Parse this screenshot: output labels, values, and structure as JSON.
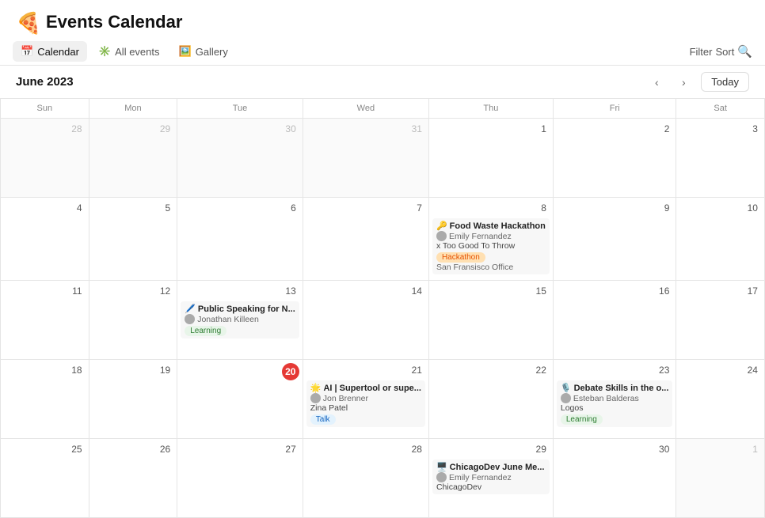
{
  "app": {
    "title": "Events Calendar",
    "logo_emoji": "🍕"
  },
  "nav": {
    "tabs": [
      {
        "id": "calendar",
        "label": "Calendar",
        "icon": "📅",
        "active": true
      },
      {
        "id": "all-events",
        "label": "All events",
        "icon": "✳️",
        "active": false
      },
      {
        "id": "gallery",
        "label": "Gallery",
        "icon": "🖼️",
        "active": false
      }
    ]
  },
  "toolbar": {
    "filter_label": "Filter",
    "sort_label": "Sort",
    "search_icon": "🔍"
  },
  "calendar": {
    "month_label": "June 2023",
    "today_btn": "Today",
    "prev_icon": "‹",
    "next_icon": "›",
    "day_headers": [
      "Sun",
      "Mon",
      "Tue",
      "Wed",
      "Thu",
      "Fri",
      "Sat"
    ]
  },
  "weeks": [
    {
      "days": [
        {
          "num": "28",
          "outside": true,
          "events": []
        },
        {
          "num": "29",
          "outside": true,
          "events": []
        },
        {
          "num": "30",
          "outside": true,
          "events": []
        },
        {
          "num": "31",
          "outside": true,
          "events": []
        },
        {
          "num": "Jun 1",
          "display": "1",
          "outside": false,
          "events": []
        },
        {
          "num": "2",
          "outside": false,
          "events": []
        },
        {
          "num": "3",
          "outside": false,
          "events": []
        }
      ]
    },
    {
      "days": [
        {
          "num": "4",
          "outside": false,
          "events": []
        },
        {
          "num": "5",
          "outside": false,
          "events": []
        },
        {
          "num": "6",
          "outside": false,
          "events": []
        },
        {
          "num": "7",
          "outside": false,
          "events": []
        },
        {
          "num": "8",
          "outside": false,
          "events": [
            {
              "title": "Food Waste Hackathon",
              "emoji": "🔑",
              "person": "Emily Fernandez",
              "org": "x Too Good To Throw",
              "badge": "Hackathon",
              "badge_class": "badge-hackathon",
              "location": "San Fransisco Office"
            }
          ]
        },
        {
          "num": "9",
          "outside": false,
          "events": []
        },
        {
          "num": "10",
          "outside": false,
          "events": []
        }
      ]
    },
    {
      "days": [
        {
          "num": "11",
          "outside": false,
          "events": []
        },
        {
          "num": "12",
          "outside": false,
          "events": []
        },
        {
          "num": "13",
          "outside": false,
          "events": [
            {
              "title": "Public Speaking for N...",
              "emoji": "🖊️",
              "person": "Jonathan Killeen",
              "badge": "Learning",
              "badge_class": "badge-learning"
            }
          ]
        },
        {
          "num": "14",
          "outside": false,
          "events": []
        },
        {
          "num": "15",
          "outside": false,
          "events": []
        },
        {
          "num": "16",
          "outside": false,
          "events": []
        },
        {
          "num": "17",
          "outside": false,
          "events": []
        }
      ]
    },
    {
      "days": [
        {
          "num": "18",
          "outside": false,
          "events": []
        },
        {
          "num": "19",
          "outside": false,
          "events": []
        },
        {
          "num": "20",
          "outside": false,
          "today": true,
          "events": []
        },
        {
          "num": "21",
          "outside": false,
          "events": [
            {
              "title": "AI | Supertool or supe...",
              "emoji": "🌟",
              "person": "Jon Brenner",
              "org": "Zina Patel",
              "badge": "Talk",
              "badge_class": "badge-talk"
            }
          ]
        },
        {
          "num": "22",
          "outside": false,
          "events": []
        },
        {
          "num": "23",
          "outside": false,
          "events": [
            {
              "title": "Debate Skills in the o...",
              "emoji": "🎙️",
              "person": "Esteban Balderas",
              "org": "Logos",
              "badge": "Learning",
              "badge_class": "badge-learning"
            }
          ]
        },
        {
          "num": "24",
          "outside": false,
          "events": []
        }
      ]
    },
    {
      "days": [
        {
          "num": "25",
          "outside": false,
          "events": []
        },
        {
          "num": "26",
          "outside": false,
          "events": []
        },
        {
          "num": "27",
          "outside": false,
          "events": []
        },
        {
          "num": "28",
          "outside": false,
          "events": []
        },
        {
          "num": "29",
          "outside": false,
          "events": [
            {
              "title": "ChicagoDev June Me...",
              "emoji": "🖥️",
              "person": "Emily Fernandez",
              "org": "ChicagoDev"
            }
          ]
        },
        {
          "num": "30",
          "outside": false,
          "events": []
        },
        {
          "num": "Jul 1",
          "display": "1",
          "outside": true,
          "events": []
        }
      ]
    }
  ]
}
